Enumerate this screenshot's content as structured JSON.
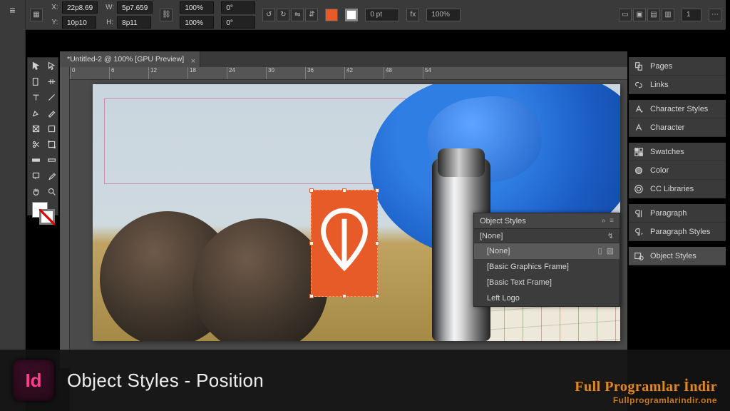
{
  "control_bar": {
    "x_label": "X:",
    "x_value": "22p8.69",
    "y_label": "Y:",
    "y_value": "10p10",
    "w_label": "W:",
    "w_value": "5p7.659",
    "h_label": "H:",
    "h_value": "8p11",
    "scale_x": "100%",
    "scale_y": "100%",
    "rotate": "0°",
    "shear": "0°",
    "stroke_w": "0 pt",
    "opacity": "100%",
    "fx": "fx",
    "page_num": "1"
  },
  "document_tab": {
    "title": "*Untitled-2 @ 100% [GPU Preview]"
  },
  "ruler_marks": [
    "0",
    "6",
    "12",
    "18",
    "24",
    "30",
    "36",
    "42",
    "48",
    "54"
  ],
  "panel": {
    "title": "Object Styles",
    "current": "[None]",
    "items": [
      "[None]",
      "[Basic Graphics Frame]",
      "[Basic Text Frame]",
      "Left Logo"
    ]
  },
  "dock": {
    "items": [
      {
        "icon": "pages",
        "label": "Pages"
      },
      {
        "icon": "links",
        "label": "Links"
      },
      {
        "gap": true
      },
      {
        "icon": "char-styles",
        "label": "Character Styles"
      },
      {
        "icon": "character",
        "label": "Character"
      },
      {
        "gap": true
      },
      {
        "icon": "swatches",
        "label": "Swatches"
      },
      {
        "icon": "color",
        "label": "Color"
      },
      {
        "icon": "cc",
        "label": "CC Libraries"
      },
      {
        "gap": true
      },
      {
        "icon": "paragraph",
        "label": "Paragraph"
      },
      {
        "icon": "para-styles",
        "label": "Paragraph Styles"
      },
      {
        "gap": true
      },
      {
        "icon": "obj-styles",
        "label": "Object Styles",
        "selected": true
      }
    ]
  },
  "banner": {
    "app_mark": "Id",
    "title": "Object Styles - Position"
  },
  "watermark": {
    "line1": "Full Programlar İndir",
    "line2": "Fullprogramlarindir.one"
  }
}
